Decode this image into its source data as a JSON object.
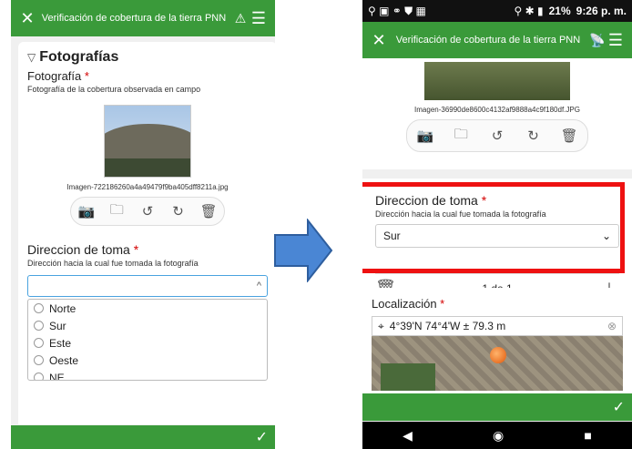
{
  "left": {
    "header_title": "Verificación de cobertura de la tierra PNN",
    "section_title": "Fotografías",
    "photo_label": "Fotografía",
    "photo_hint": "Fotografía de la cobertura observada en campo",
    "image_name": "Imagen-722186260a4a49479f9ba405dff8211a.jpg",
    "direction_label": "Direccion de toma",
    "direction_hint": "Dirección hacia la cual fue tomada la fotografía",
    "options": [
      "Norte",
      "Sur",
      "Este",
      "Oeste",
      "NE"
    ]
  },
  "right": {
    "status_time": "9:26 p. m.",
    "status_battery": "21%",
    "header_title": "Verificación de cobertura de la tierra PNN",
    "image_name": "Imagen-36990de8600c4132af9888a4c9f180df.JPG",
    "direction_label": "Direccion de toma",
    "direction_hint": "Dirección hacia la cual fue tomada la fotografía",
    "selected_value": "Sur",
    "pager": "1 de 1",
    "location_label": "Localización",
    "location_value": "4°39'N 74°4'W ± 79.3 m"
  },
  "colors": {
    "header_green": "#3a9a3a",
    "highlight_red": "#ee1111",
    "arrow_blue": "#4a86d4"
  },
  "required_marker": "*"
}
